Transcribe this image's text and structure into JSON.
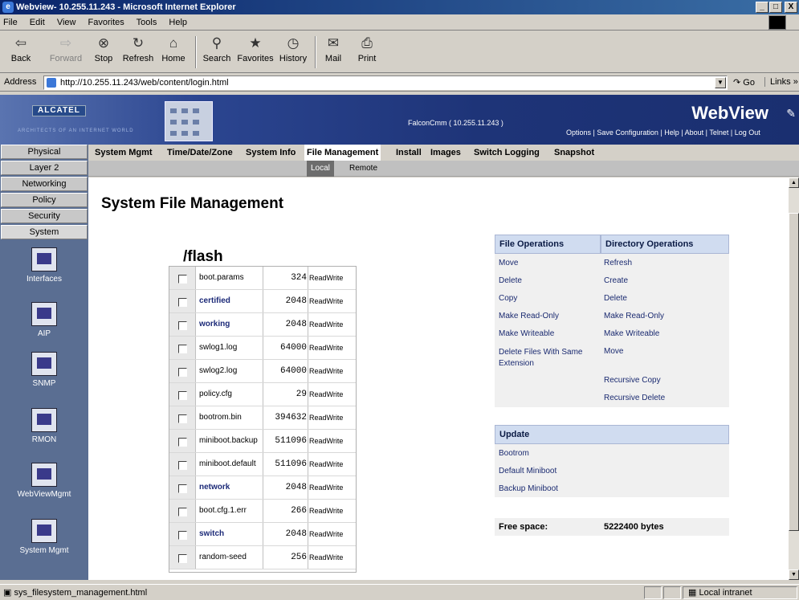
{
  "window": {
    "title": "Webview- 10.255.11.243 - Microsoft Internet Explorer",
    "controls": [
      "_",
      "□",
      "X"
    ]
  },
  "menu": [
    "File",
    "Edit",
    "View",
    "Favorites",
    "Tools",
    "Help"
  ],
  "toolbar": {
    "back": "Back",
    "forward": "Forward",
    "stop": "Stop",
    "refresh": "Refresh",
    "home": "Home",
    "search": "Search",
    "favorites": "Favorites",
    "history": "History",
    "mail": "Mail",
    "print": "Print"
  },
  "address": {
    "label": "Address",
    "url": "http://10.255.11.243/web/content/login.html",
    "go": "Go",
    "links": "Links »"
  },
  "banner": {
    "brand": "ALCATEL",
    "tagline": "ARCHITECTS OF AN INTERNET WORLD",
    "device": "FalconCmm  ( 10.255.11.243 )",
    "product": "WebView",
    "links": [
      "Options",
      "Save Configuration",
      "Help",
      "About",
      "Telnet",
      "Log Out"
    ],
    "link_sep": " | "
  },
  "left_nav": {
    "categories": [
      "Physical",
      "Layer 2",
      "Networking",
      "Policy",
      "Security",
      "System"
    ],
    "icons": [
      {
        "label": "Interfaces",
        "icon": "interfaces-icon"
      },
      {
        "label": "AIP",
        "icon": "aip-icon"
      },
      {
        "label": "SNMP",
        "icon": "snmp-icon"
      },
      {
        "label": "RMON",
        "icon": "rmon-icon"
      },
      {
        "label": "WebViewMgmt",
        "icon": "webviewmgmt-icon"
      },
      {
        "label": "System Mgmt",
        "icon": "system-mgmt-icon"
      }
    ]
  },
  "top_nav": {
    "items": [
      "System Mgmt",
      "Time/Date/Zone",
      "System Info",
      "File Management",
      "Install",
      "Images",
      "Switch Logging",
      "Snapshot"
    ],
    "active": "File Management"
  },
  "sub_nav": {
    "items": [
      "Local",
      "Remote"
    ],
    "active": "Local"
  },
  "page": {
    "title": "System File Management",
    "directory": "/flash"
  },
  "files": [
    {
      "name": "boot.params",
      "size": "324",
      "perm": "ReadWrite",
      "is_dir": false
    },
    {
      "name": "certified",
      "size": "2048",
      "perm": "ReadWrite",
      "is_dir": true
    },
    {
      "name": "working",
      "size": "2048",
      "perm": "ReadWrite",
      "is_dir": true
    },
    {
      "name": "swlog1.log",
      "size": "64000",
      "perm": "ReadWrite",
      "is_dir": false
    },
    {
      "name": "swlog2.log",
      "size": "64000",
      "perm": "ReadWrite",
      "is_dir": false
    },
    {
      "name": "policy.cfg",
      "size": "29",
      "perm": "ReadWrite",
      "is_dir": false
    },
    {
      "name": "bootrom.bin",
      "size": "394632",
      "perm": "ReadWrite",
      "is_dir": false
    },
    {
      "name": "miniboot.backup",
      "size": "511096",
      "perm": "ReadWrite",
      "is_dir": false
    },
    {
      "name": "miniboot.default",
      "size": "511096",
      "perm": "ReadWrite",
      "is_dir": false
    },
    {
      "name": "network",
      "size": "2048",
      "perm": "ReadWrite",
      "is_dir": true
    },
    {
      "name": "boot.cfg.1.err",
      "size": "266",
      "perm": "ReadWrite",
      "is_dir": false
    },
    {
      "name": "switch",
      "size": "2048",
      "perm": "ReadWrite",
      "is_dir": true
    },
    {
      "name": "random-seed",
      "size": "256",
      "perm": "ReadWrite",
      "is_dir": false
    }
  ],
  "file_operations": {
    "header": "File Operations",
    "items": [
      "Move",
      "Delete",
      "Copy",
      "Make Read-Only",
      "Make Writeable",
      "Delete Files With Same Extension"
    ]
  },
  "directory_operations": {
    "header": "Directory Operations",
    "items": [
      "Refresh",
      "Create",
      "Delete",
      "Make Read-Only",
      "Make Writeable",
      "Move",
      "Recursive Copy",
      "Recursive Delete"
    ]
  },
  "update": {
    "header": "Update",
    "items": [
      "Bootrom",
      "Default Miniboot",
      "Backup Miniboot"
    ]
  },
  "free_space": {
    "label": "Free space:",
    "value": "5222400 bytes"
  },
  "status": {
    "message": "sys_filesystem_management.html",
    "zone": "Local intranet"
  }
}
